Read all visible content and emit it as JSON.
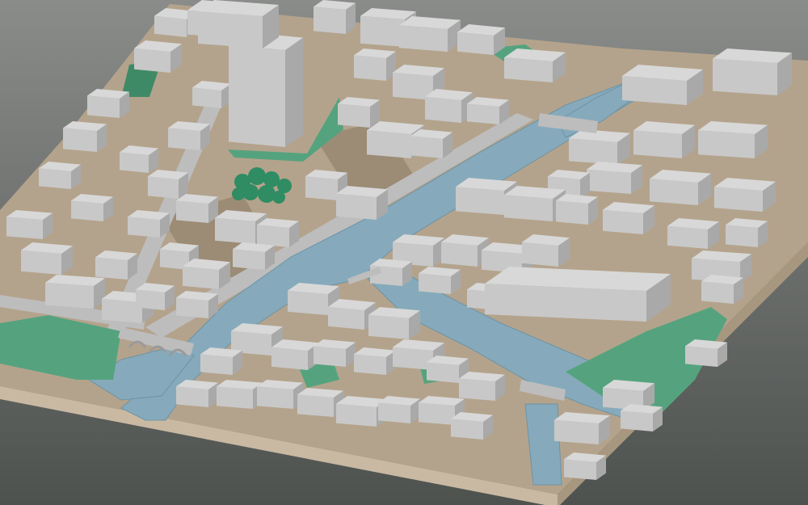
{
  "scene": {
    "kind": "3d-city-model",
    "view": "oblique-aerial",
    "labels": []
  },
  "colors": {
    "background_top": "#8a8c8a",
    "background_bottom": "#4e524f",
    "terrain": "#b4a38c",
    "terrain_shade": "#9c8b75",
    "base_front": "#c9b9a3",
    "base_side": "#a8977f",
    "water": "#86aabb",
    "water_edge": "#6d93a6",
    "vegetation": "#55a37e",
    "vegetation_dark": "#3f8a66",
    "tree": "#2f8c63",
    "roof": "#d8d8d8",
    "wall_lit": "#c8c8c8",
    "wall_shade": "#a9a9a9",
    "road": "#bdbdbd"
  },
  "features": {
    "water_channels": [
      "main-canal",
      "right-branch",
      "left-branch-to-bridge",
      "bottom-branch"
    ],
    "bridges": [
      "arched-bridge-left",
      "bridge-right-junction",
      "bridge-top-right",
      "footbridge-center"
    ],
    "green_areas": [
      "park-bottom-left",
      "park-right-bank",
      "plaza-tower",
      "tree-cluster",
      "garden-right"
    ],
    "landmarks": [
      "tower-block",
      "long-arcade-building",
      "angled-block-top-right"
    ]
  }
}
